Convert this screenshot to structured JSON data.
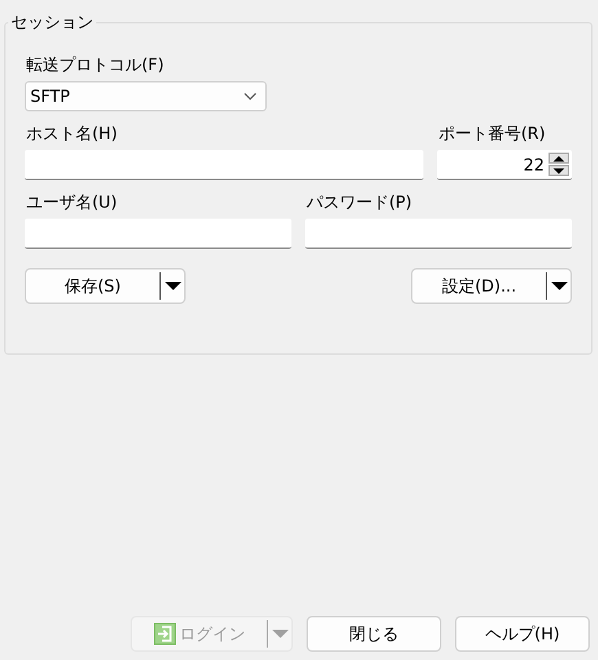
{
  "session": {
    "title": "セッション",
    "protocol": {
      "label": "転送プロトコル(F)",
      "value": "SFTP"
    },
    "host": {
      "label": "ホスト名(H)"
    },
    "port": {
      "label": "ポート番号(R)",
      "value": "22"
    },
    "user": {
      "label": "ユーザ名(U)"
    },
    "password": {
      "label": "パスワード(P)"
    },
    "buttons": [
      {
        "label": "保存(S)",
        "kind": "split",
        "disabled": false
      },
      {
        "label": "設定(D)...",
        "kind": "split",
        "disabled": false
      }
    ]
  },
  "footer": [
    {
      "label": "ログイン",
      "kind": "login",
      "disabled": true
    },
    {
      "label": "閉じる",
      "kind": "plain",
      "disabled": false
    },
    {
      "label": "ヘルプ(H)",
      "kind": "plain",
      "disabled": false
    }
  ]
}
